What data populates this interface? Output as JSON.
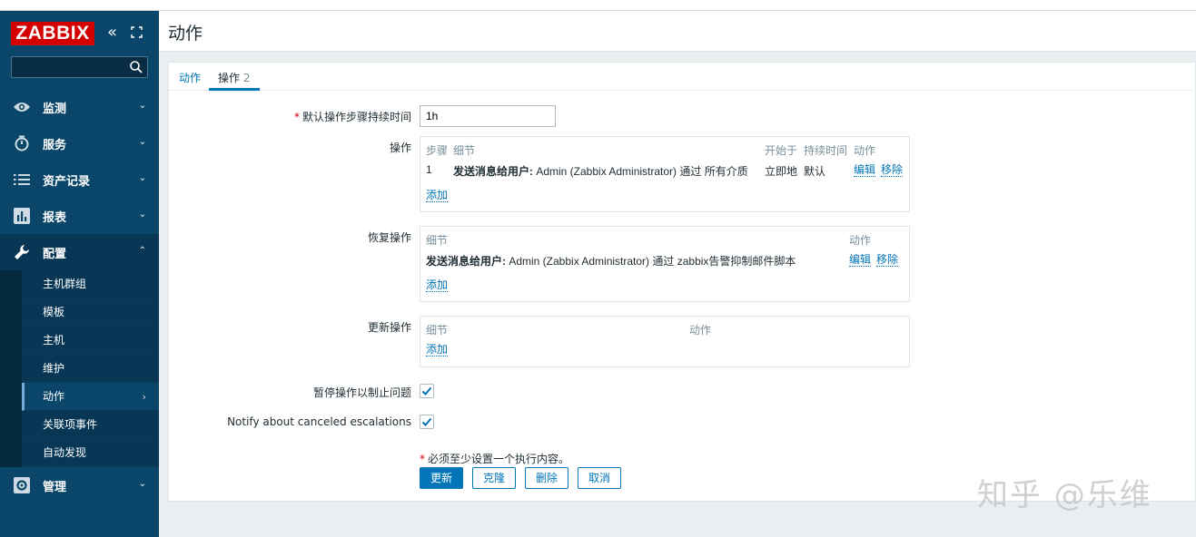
{
  "sidebar": {
    "logo": "ZABBIX",
    "search_placeholder": "",
    "menu": [
      {
        "label": "监测",
        "icon": "eye-icon"
      },
      {
        "label": "服务",
        "icon": "clock-icon"
      },
      {
        "label": "资产记录",
        "icon": "list-icon"
      },
      {
        "label": "报表",
        "icon": "bar-chart-icon"
      },
      {
        "label": "配置",
        "icon": "wrench-icon"
      },
      {
        "label": "管理",
        "icon": "gear-icon"
      }
    ],
    "config_submenu": [
      "主机群组",
      "模板",
      "主机",
      "维护",
      "动作",
      "关联项事件",
      "自动发现"
    ]
  },
  "page": {
    "title": "动作",
    "tabs": [
      {
        "label": "动作"
      },
      {
        "label": "操作",
        "count": "2"
      }
    ]
  },
  "form": {
    "duration_label": "默认操作步骤持续时间",
    "duration_value": "1h",
    "operations": {
      "label": "操作",
      "headers": [
        "步骤",
        "细节",
        "开始于",
        "持续时间",
        "动作"
      ],
      "row": {
        "step": "1",
        "detail_bold": "发送消息给用户:",
        "detail_rest": " Admin (Zabbix Administrator) 通过 所有介质",
        "start": "立即地",
        "duration": "默认",
        "edit": "编辑",
        "remove": "移除"
      },
      "add": "添加"
    },
    "recovery": {
      "label": "恢复操作",
      "headers": [
        "细节",
        "动作"
      ],
      "row": {
        "detail_bold": "发送消息给用户:",
        "detail_rest": " Admin (Zabbix Administrator) 通过 zabbix告警抑制邮件脚本",
        "edit": "编辑",
        "remove": "移除"
      },
      "add": "添加"
    },
    "update": {
      "label": "更新操作",
      "headers": [
        "细节",
        "动作"
      ],
      "add": "添加"
    },
    "pause_label": "暂停操作以制止问题",
    "notify_label": "Notify about canceled escalations",
    "required_note": "必须至少设置一个执行内容。",
    "buttons": {
      "update": "更新",
      "clone": "克隆",
      "delete": "删除",
      "cancel": "取消"
    }
  },
  "watermark": "知乎 @乐维",
  "colors": {
    "sidebar": "#0a466a",
    "accent": "#0275b8",
    "logo": "#d40000"
  }
}
